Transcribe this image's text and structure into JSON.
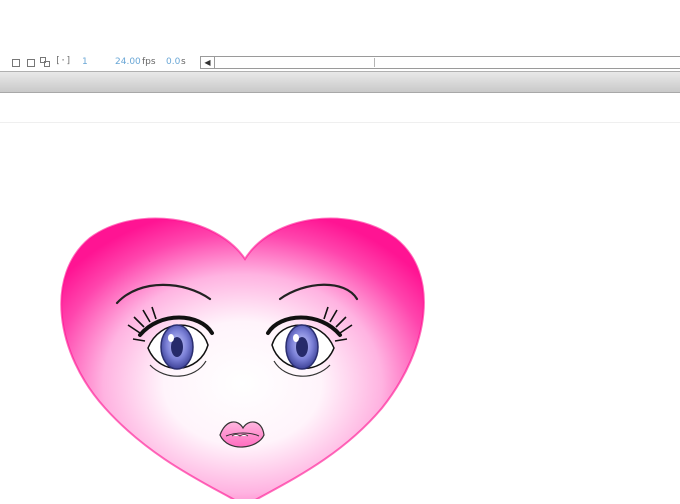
{
  "timeline": {
    "current_frame": "1",
    "frame_rate_value": "24.00",
    "frame_rate_unit": "fps",
    "elapsed_time_value": "0.0",
    "elapsed_time_unit": "s",
    "scroll_left_arrow": "◀"
  },
  "colors": {
    "heart_pink": "#ff1d9d",
    "heart_inner": "#ffe6f7",
    "iris_blue": "#7a7fd6",
    "lips_pink": "#ff8fcf",
    "timeline_value_blue": "#6aa7d6"
  }
}
